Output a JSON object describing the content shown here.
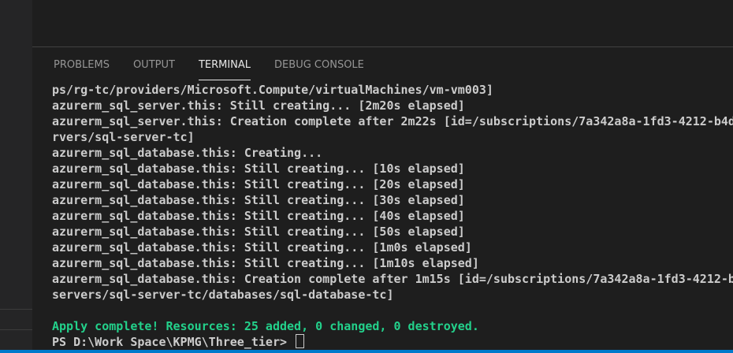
{
  "panel": {
    "tabs": [
      {
        "label": "PROBLEMS",
        "active": false
      },
      {
        "label": "OUTPUT",
        "active": false
      },
      {
        "label": "TERMINAL",
        "active": true
      },
      {
        "label": "DEBUG CONSOLE",
        "active": false
      }
    ]
  },
  "terminal": {
    "lines": [
      "ps/rg-tc/providers/Microsoft.Compute/virtualMachines/vm-vm003]",
      "azurerm_sql_server.this: Still creating... [2m20s elapsed]",
      "azurerm_sql_server.this: Creation complete after 2m22s [id=/subscriptions/7a342a8a-1fd3-4212-b4d",
      "rvers/sql-server-tc]",
      "azurerm_sql_database.this: Creating...",
      "azurerm_sql_database.this: Still creating... [10s elapsed]",
      "azurerm_sql_database.this: Still creating... [20s elapsed]",
      "azurerm_sql_database.this: Still creating... [30s elapsed]",
      "azurerm_sql_database.this: Still creating... [40s elapsed]",
      "azurerm_sql_database.this: Still creating... [50s elapsed]",
      "azurerm_sql_database.this: Still creating... [1m0s elapsed]",
      "azurerm_sql_database.this: Still creating... [1m10s elapsed]",
      "azurerm_sql_database.this: Creation complete after 1m15s [id=/subscriptions/7a342a8a-1fd3-4212-b",
      "servers/sql-server-tc/databases/sql-database-tc]",
      "",
      "Apply complete! Resources: 25 added, 0 changed, 0 destroyed."
    ],
    "prompt": "PS D:\\Work Space\\KPMG\\Three_tier> ",
    "colors": {
      "text": "#cccccc",
      "success": "#23d18b",
      "background": "#1e1e1e"
    }
  }
}
